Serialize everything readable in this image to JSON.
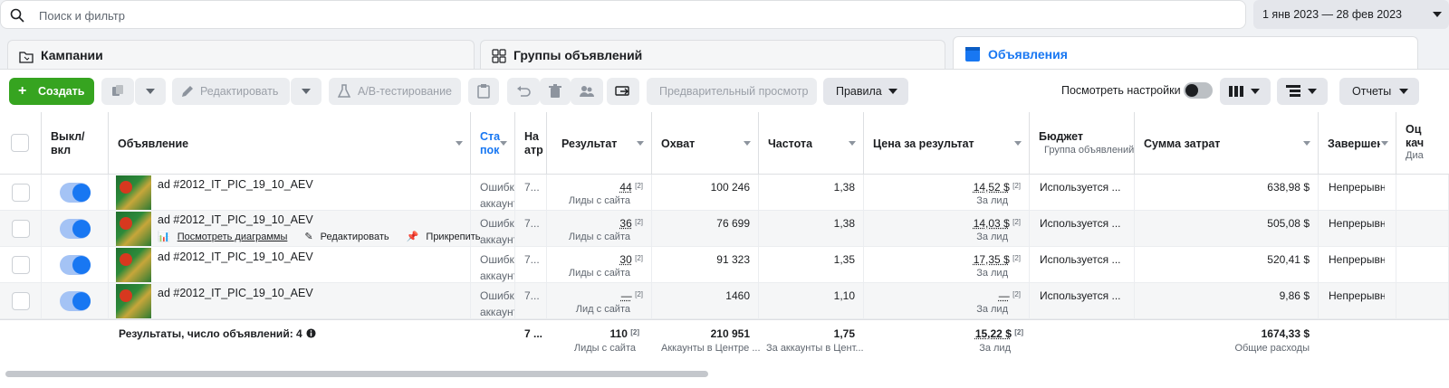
{
  "search": {
    "placeholder": "Поиск и фильтр"
  },
  "date_range": "1 янв 2023 — 28 фев 2023",
  "tabs": [
    {
      "label": "Кампании"
    },
    {
      "label": "Группы объявлений"
    },
    {
      "label": "Объявления"
    }
  ],
  "toolbar": {
    "create": "Создать",
    "edit": "Редактировать",
    "ab_test": "A/B-тестирование",
    "preview": "Предварительный просмотр",
    "rules": "Правила",
    "view_settings": "Посмотреть настройки",
    "reports": "Отчеты"
  },
  "columns": {
    "toggle": "Выкл/\nвкл",
    "ad": "Объявление",
    "status": "Ста\nпок",
    "attr": "На\nатр",
    "result": "Результат",
    "reach": "Охват",
    "frequency": "Частота",
    "cpr": "Цена за результат",
    "budget": "Бюджет",
    "budget_sub": "Группа объявлений",
    "spend": "Сумма затрат",
    "ends": "Завершен",
    "quality": "Оц\nкач",
    "quality_sub": "Диа"
  },
  "rows": [
    {
      "name": "ad #2012_IT_PIC_19_10_AEV",
      "status": "Ошибка\nаккаунт",
      "attr": "7...",
      "result": "44",
      "result_unit": "Лиды с сайта",
      "reach": "100 246",
      "frequency": "1,38",
      "cpr": "14,52 $",
      "cpr_unit": "За лид",
      "budget": "Используется ...",
      "spend": "638,98 $",
      "ends": "Непрерывно"
    },
    {
      "name": "ad #2012_IT_PIC_19_10_AEV",
      "status": "Ошибка\nаккаунт",
      "attr": "7...",
      "result": "36",
      "result_unit": "Лиды с сайта",
      "reach": "76 699",
      "frequency": "1,38",
      "cpr": "14,03 $",
      "cpr_unit": "За лид",
      "budget": "Используется ...",
      "spend": "505,08 $",
      "ends": "Непрерывно"
    },
    {
      "name": "ad #2012_IT_PIC_19_10_AEV",
      "status": "Ошибка\nаккаунт",
      "attr": "7...",
      "result": "30",
      "result_unit": "Лиды с сайта",
      "reach": "91 323",
      "frequency": "1,35",
      "cpr": "17,35 $",
      "cpr_unit": "За лид",
      "budget": "Используется ...",
      "spend": "520,41 $",
      "ends": "Непрерывно"
    },
    {
      "name": "ad #2012_IT_PIC_19_10_AEV",
      "status": "Ошибка\nаккаунт",
      "attr": "7...",
      "result": "—",
      "result_unit": "Лид с сайта",
      "reach": "1460",
      "frequency": "1,10",
      "cpr": "—",
      "cpr_unit": "За лид",
      "budget": "Используется ...",
      "spend": "9,86 $",
      "ends": "Непрерывно"
    }
  ],
  "footnote": "[2]",
  "row_actions": {
    "charts": "Посмотреть диаграммы",
    "edit": "Редактировать",
    "pin": "Прикрепить"
  },
  "totals": {
    "label": "Результаты, число объявлений: 4",
    "attr": "7 ...",
    "result": "110",
    "result_unit": "Лиды с сайта",
    "reach": "210 951",
    "reach_unit": "Аккаунты в Центре ...",
    "frequency": "1,75",
    "frequency_unit": "За аккаунты в Цент...",
    "cpr": "15,22 $",
    "cpr_unit": "За лид",
    "spend": "1674,33 $",
    "spend_unit": "Общие расходы"
  },
  "colors": {
    "accent": "#1877f2",
    "create": "#36a420"
  }
}
